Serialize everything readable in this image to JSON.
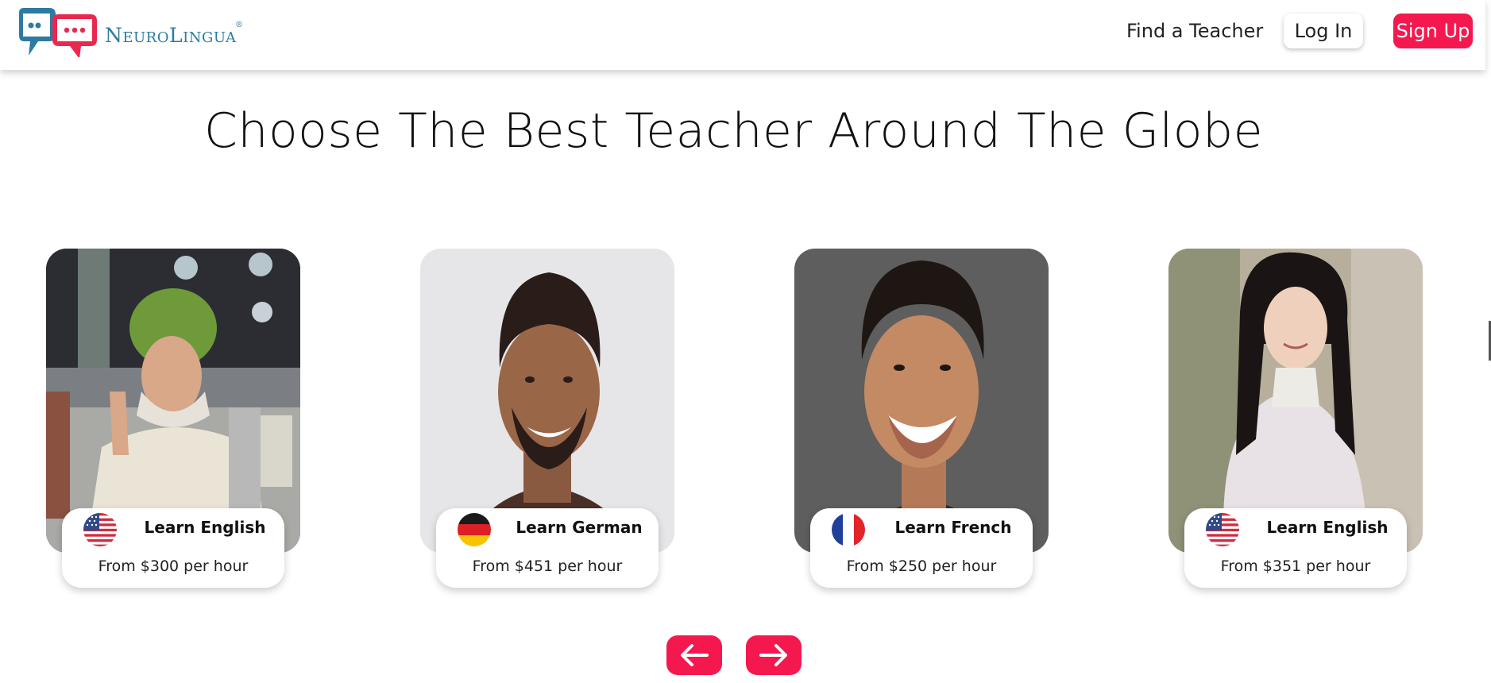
{
  "brand": {
    "name_first": "N",
    "name_rest": "EURO",
    "name_second": "L",
    "name_second_rest": "INGUA",
    "mark": "®",
    "blue": "#2d7aa3",
    "red": "#f5184f"
  },
  "nav": {
    "find_teacher": "Find a Teacher",
    "login": "Log In",
    "signup": "Sign Up"
  },
  "headline": "Choose The Best Teacher Around The Globe",
  "cards": [
    {
      "flag": "us-flag-icon",
      "learn": "Learn English",
      "price": "From $300 per hour"
    },
    {
      "flag": "de-flag-icon",
      "learn": "Learn German",
      "price": "From $451 per hour"
    },
    {
      "flag": "fr-flag-icon",
      "learn": "Learn French",
      "price": "From $250 per hour"
    },
    {
      "flag": "us-flag-icon",
      "learn": "Learn English",
      "price": "From $351 per hour"
    }
  ],
  "carousel": {
    "prev_icon": "arrow-left-icon",
    "next_icon": "arrow-right-icon"
  }
}
